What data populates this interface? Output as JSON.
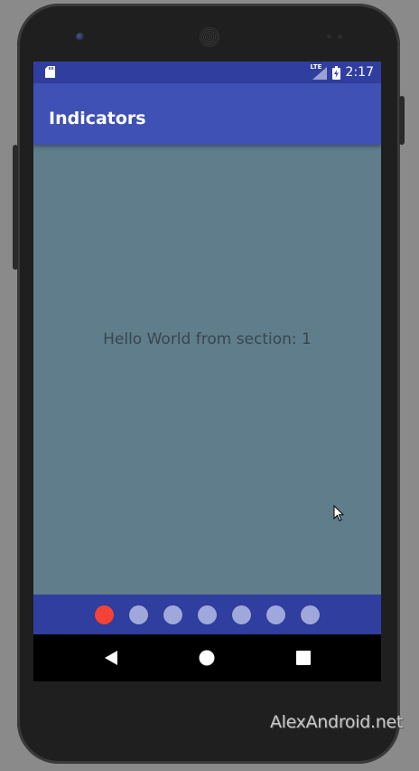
{
  "status_bar": {
    "network": "LTE",
    "time": "2:17"
  },
  "app_bar": {
    "title": "Indicators"
  },
  "content": {
    "text": "Hello World from section: 1"
  },
  "indicators": {
    "count": 7,
    "active_index": 0,
    "active_color": "#f44336",
    "inactive_color": "#9fa8da"
  },
  "navigation": {
    "buttons": [
      "back-icon",
      "home-icon",
      "recent-apps-icon"
    ]
  },
  "watermark": {
    "text": "AlexAndroid.net"
  },
  "colors": {
    "status_bar": "#303f9f",
    "app_bar": "#3f51b5",
    "content_bg": "#607d8b"
  }
}
